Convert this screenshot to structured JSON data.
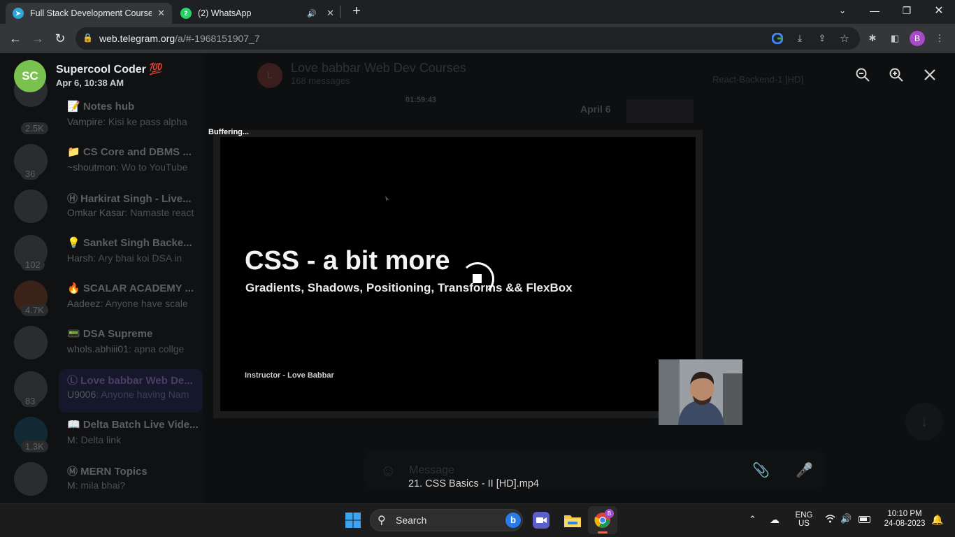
{
  "browser": {
    "tabs": [
      {
        "title": "Full Stack Development Course -",
        "icon": "telegram-icon",
        "active": true
      },
      {
        "title": "(2) WhatsApp",
        "icon": "whatsapp-icon",
        "active": false,
        "badge": "2"
      }
    ],
    "url_host": "web.telegram.org",
    "url_path": "/a/#-1968151907_7",
    "profile_initial": "B"
  },
  "viewer": {
    "sender_initials": "SC",
    "sender_name": "Supercool Coder 💯",
    "date": "Apr 6, 10:38 AM",
    "buffering_text": "Buffering...",
    "slide_title": "CSS - a bit more",
    "slide_subtitle": "Gradients, Shadows, Positioning, Transforms && FlexBox",
    "slide_instructor": "Instructor - Love Babbar",
    "file_name": "21. CSS Basics - II [HD].mp4"
  },
  "background": {
    "chat_title": "Love babbar Web Dev Courses",
    "chat_subtitle": "168 messages",
    "pinned_title": "React-Backend-1 [HD]",
    "date_chip": "April 6",
    "video_time": "01:59:43",
    "composer_placeholder": "Message",
    "chats": [
      {
        "name": "📝 Notes hub",
        "sender": "Vampire",
        "text": "Kisi ke pass alpha",
        "badge": "2.5K"
      },
      {
        "name": "📁 CS Core and DBMS ...",
        "sender": "~shoutmon",
        "text": "Wo to YouTube",
        "badge": "36"
      },
      {
        "name": "Ⓗ Harkirat Singh - Live...",
        "sender": "Omkar Kasar",
        "text": "Namaste react",
        "badge": ""
      },
      {
        "name": "💡 Sanket Singh Backe...",
        "sender": "Harsh",
        "text": "Ary bhai koi DSA in",
        "badge": "102"
      },
      {
        "name": "🔥 SCALAR ACADEMY ...",
        "sender": "Aadeez",
        "text": "Anyone have scale",
        "badge": "4.7K"
      },
      {
        "name": "📟 DSA Supreme",
        "sender": "whols.abhiii01",
        "text": "apna collge",
        "badge": ""
      },
      {
        "name": "Ⓛ Love babbar Web De...",
        "sender": "U9006",
        "text": "Anyone having Nam",
        "badge": "83"
      },
      {
        "name": "📖 Delta Batch Live Vide...",
        "sender": "M",
        "text": "Delta link",
        "badge": "1.3K"
      },
      {
        "name": "Ⓜ MERN Topics",
        "sender": "M",
        "text": "mila bhai?",
        "badge": ""
      }
    ]
  },
  "taskbar": {
    "search_label": "Search",
    "lang_line1": "ENG",
    "lang_line2": "US",
    "time": "10:10 PM",
    "date": "24-08-2023"
  }
}
